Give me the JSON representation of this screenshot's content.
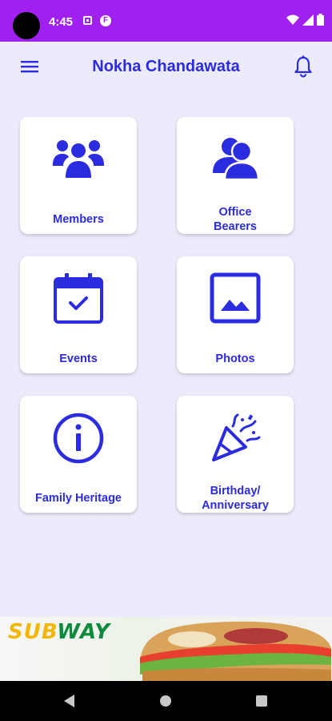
{
  "status_bar": {
    "time": "4:45",
    "icon_b": "F"
  },
  "app_bar": {
    "title": "Nokha Chandawata",
    "menu_icon": "hamburger-menu-icon",
    "notification_icon": "bell-icon"
  },
  "tiles": [
    {
      "label": "Members",
      "icon": "members-group-icon"
    },
    {
      "label": "Office\nBearers",
      "icon": "office-bearers-icon"
    },
    {
      "label": "Events",
      "icon": "calendar-check-icon"
    },
    {
      "label": "Photos",
      "icon": "photo-image-icon"
    },
    {
      "label": "Family Heritage",
      "icon": "info-circle-icon"
    },
    {
      "label": "Birthday/\nAnniversary",
      "icon": "party-popper-icon"
    }
  ],
  "ad": {
    "brand_part1": "SUB",
    "brand_part2": "WAY"
  },
  "colors": {
    "accent": "#2B2BE0",
    "status_bar": "#A020F0",
    "background": "#ECEBFB"
  }
}
